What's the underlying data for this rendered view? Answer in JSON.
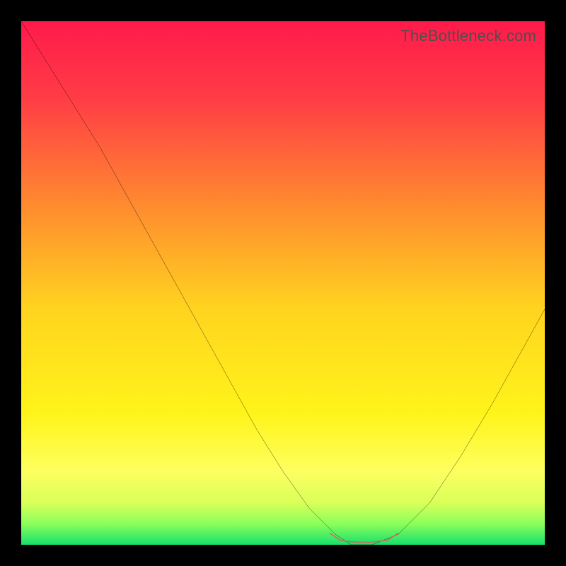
{
  "watermark": "TheBottleneck.com",
  "colors": {
    "frame": "#000000",
    "curve": "#000000",
    "accent_segment": "#cf6a5e"
  },
  "chart_data": {
    "type": "line",
    "title": "",
    "xlabel": "",
    "ylabel": "",
    "xlim": [
      0,
      100
    ],
    "ylim": [
      0,
      100
    ],
    "grid": false,
    "legend": false,
    "annotations": [],
    "gradient_stops": [
      {
        "pos": 0.0,
        "color": "#ff1a4b"
      },
      {
        "pos": 0.15,
        "color": "#ff3d45"
      },
      {
        "pos": 0.35,
        "color": "#ff8a2f"
      },
      {
        "pos": 0.55,
        "color": "#ffd41f"
      },
      {
        "pos": 0.75,
        "color": "#fff41a"
      },
      {
        "pos": 0.86,
        "color": "#fdff60"
      },
      {
        "pos": 0.92,
        "color": "#d9ff59"
      },
      {
        "pos": 0.96,
        "color": "#8bff5a"
      },
      {
        "pos": 1.0,
        "color": "#16e06c"
      }
    ],
    "series": [
      {
        "name": "bottleneck-curve",
        "type": "line",
        "x": [
          0,
          5,
          10,
          15,
          20,
          25,
          30,
          35,
          40,
          45,
          50,
          55,
          60,
          63,
          67,
          72,
          78,
          84,
          90,
          95,
          100
        ],
        "y": [
          100,
          92,
          84,
          76,
          67,
          58,
          49,
          40,
          31,
          22,
          14,
          7,
          2,
          0,
          0,
          2,
          8,
          17,
          27,
          36,
          45
        ]
      },
      {
        "name": "accent-flat-segment",
        "type": "line",
        "x": [
          59,
          61,
          64,
          67,
          70,
          72
        ],
        "y": [
          2.2,
          0.8,
          0.5,
          0.5,
          0.9,
          2.2
        ]
      }
    ]
  }
}
